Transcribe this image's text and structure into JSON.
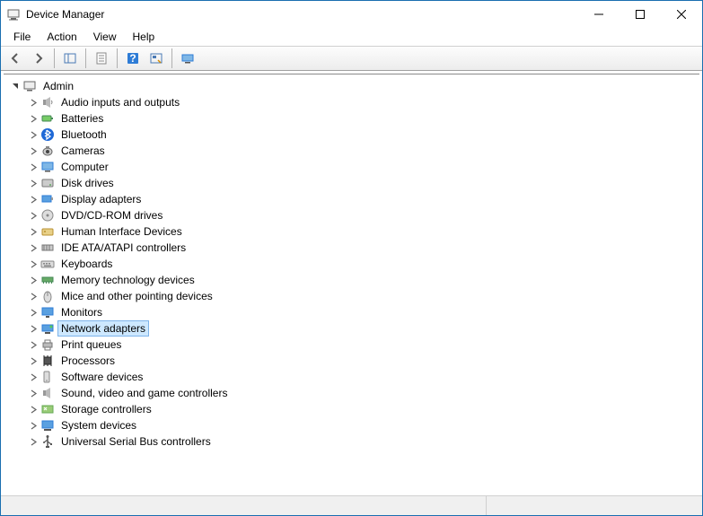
{
  "title": "Device Manager",
  "menus": {
    "file": "File",
    "action": "Action",
    "view": "View",
    "help": "Help"
  },
  "tree": {
    "root": {
      "label": "Admin",
      "expanded": true,
      "icon": "computer-root"
    },
    "children": [
      {
        "label": "Audio inputs and outputs",
        "icon": "speaker"
      },
      {
        "label": "Batteries",
        "icon": "battery"
      },
      {
        "label": "Bluetooth",
        "icon": "bluetooth"
      },
      {
        "label": "Cameras",
        "icon": "camera"
      },
      {
        "label": "Computer",
        "icon": "computer"
      },
      {
        "label": "Disk drives",
        "icon": "disk"
      },
      {
        "label": "Display adapters",
        "icon": "display-adapter"
      },
      {
        "label": "DVD/CD-ROM drives",
        "icon": "optical"
      },
      {
        "label": "Human Interface Devices",
        "icon": "hid"
      },
      {
        "label": "IDE ATA/ATAPI controllers",
        "icon": "ide"
      },
      {
        "label": "Keyboards",
        "icon": "keyboard"
      },
      {
        "label": "Memory technology devices",
        "icon": "memory"
      },
      {
        "label": "Mice and other pointing devices",
        "icon": "mouse"
      },
      {
        "label": "Monitors",
        "icon": "monitor"
      },
      {
        "label": "Network adapters",
        "icon": "network",
        "selected": true
      },
      {
        "label": "Print queues",
        "icon": "printer"
      },
      {
        "label": "Processors",
        "icon": "cpu"
      },
      {
        "label": "Software devices",
        "icon": "software"
      },
      {
        "label": "Sound, video and game controllers",
        "icon": "sound"
      },
      {
        "label": "Storage controllers",
        "icon": "storage"
      },
      {
        "label": "System devices",
        "icon": "system"
      },
      {
        "label": "Universal Serial Bus controllers",
        "icon": "usb"
      }
    ]
  },
  "colors": {
    "selection_bg": "#cde8ff",
    "selection_border": "#7eb4ea",
    "window_border": "#1a6fb0"
  }
}
